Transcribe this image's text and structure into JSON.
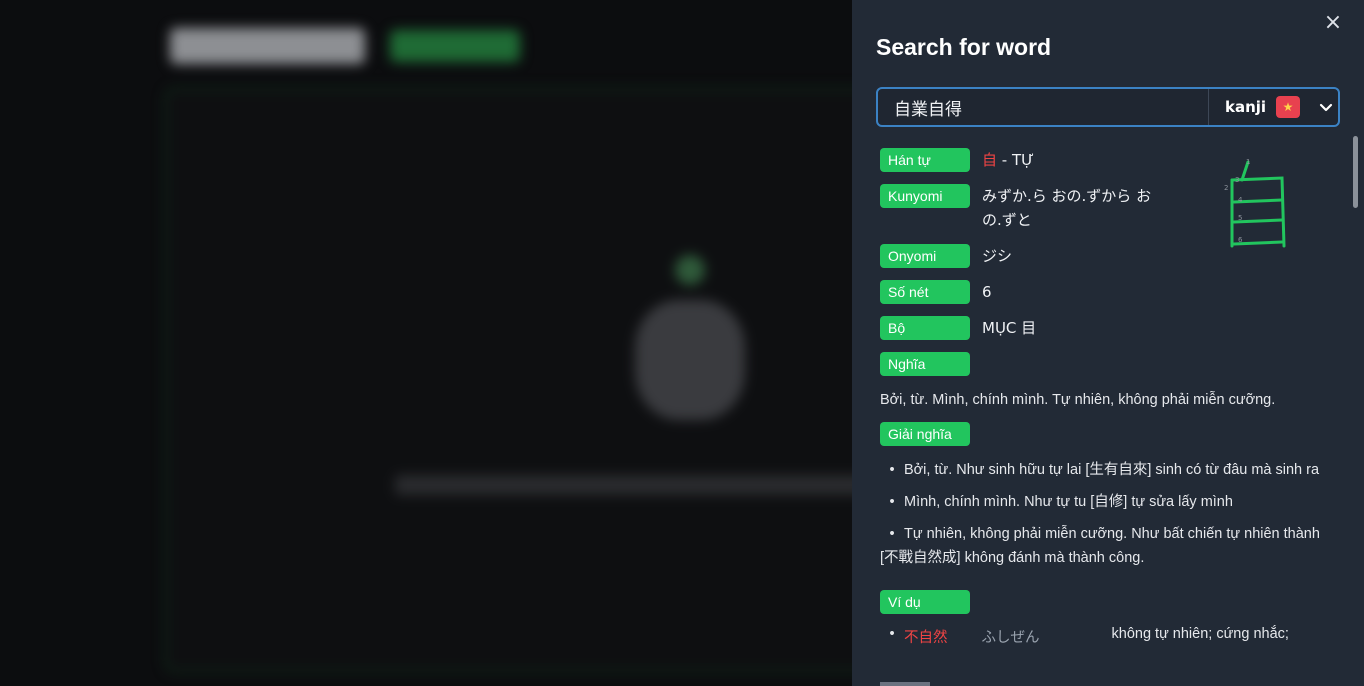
{
  "drawer": {
    "title": "Search for word",
    "close_icon": "×",
    "search": {
      "value": "自業自得"
    },
    "type_select": {
      "selected": "kanji",
      "flag": "vietnam-flag-icon"
    }
  },
  "kanji": {
    "han_tu_label": "Hán tự",
    "han_tu_char": "自",
    "han_tu_reading": "- TỰ",
    "kunyomi_label": "Kunyomi",
    "kunyomi_value": "みずか.ら おの.ずから おの.ずと",
    "onyomi_label": "Onyomi",
    "onyomi_value": "ジシ",
    "strokes_label": "Số nét",
    "strokes_value": "6",
    "radical_label": "Bộ",
    "radical_value": "MỤC 目",
    "meaning_label": "Nghĩa",
    "meaning_value": "Bởi, từ. Mình, chính mình. Tự nhiên, không phải miễn cưỡng.",
    "explain_label": "Giải nghĩa",
    "explanations": [
      "Bởi, từ. Như sinh hữu tự lai [生有自來] sinh có từ đâu mà sinh ra",
      "Mình, chính mình. Như tự tu [自修] tự sửa lấy mình",
      "Tự nhiên, không phải miễn cưỡng. Như bất chiến tự nhiên thành [不戰自然成] không đánh mà thành công."
    ],
    "example_label": "Ví dụ",
    "example": {
      "word": "不自然",
      "kana": "ふしぜん",
      "meaning": "không tự nhiên; cứng nhắc;"
    }
  },
  "colors": {
    "accent": "#22c55e",
    "panel": "#222a36",
    "highlight": "#ef4444"
  }
}
